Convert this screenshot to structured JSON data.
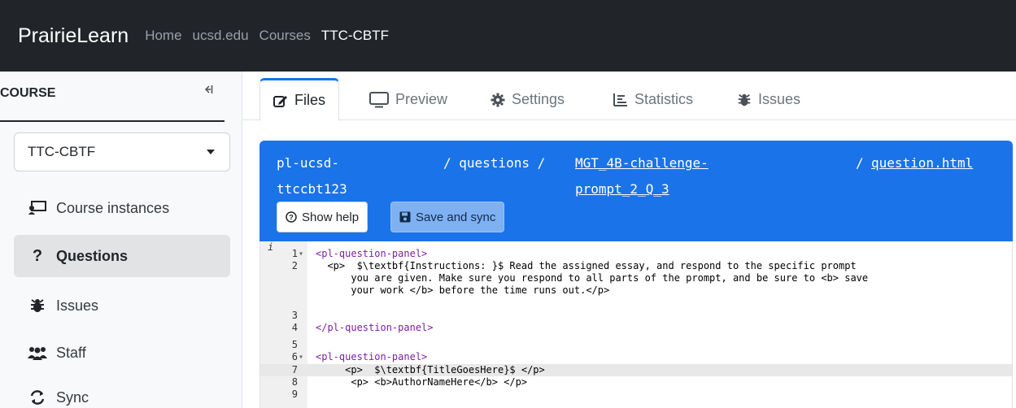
{
  "navbar": {
    "brand": "PrairieLearn",
    "links": [
      "Home",
      "ucsd.edu",
      "Courses",
      "TTC-CBTF"
    ]
  },
  "sidebar": {
    "header": "COURSE",
    "collapse_icon": "collapse-left-icon",
    "course_select": "TTC-CBTF",
    "items": [
      {
        "label": "Course instances",
        "icon": "chalkboard-icon"
      },
      {
        "label": "Questions",
        "icon": "question-icon"
      },
      {
        "label": "Issues",
        "icon": "bug-icon"
      },
      {
        "label": "Staff",
        "icon": "users-icon"
      },
      {
        "label": "Sync",
        "icon": "sync-icon"
      }
    ],
    "active_item": "Questions"
  },
  "tabs": [
    {
      "label": "Files",
      "icon": "edit-icon",
      "active": true
    },
    {
      "label": "Preview",
      "icon": "monitor-icon"
    },
    {
      "label": "Settings",
      "icon": "gear-icon"
    },
    {
      "label": "Statistics",
      "icon": "chart-icon"
    },
    {
      "label": "Issues",
      "icon": "bug-icon"
    }
  ],
  "breadcrumb": {
    "root_line1": "pl-ucsd-",
    "root_line2": "ttccbt123",
    "sep1": "/ questions /",
    "folder_line1": "MGT_4B-challenge-",
    "folder_line2": "prompt_2_Q_3",
    "sep2": "/",
    "file": "question.html"
  },
  "buttons": {
    "help": "Show help",
    "save": "Save and sync"
  },
  "editor": {
    "colors": {
      "tag": "#7a1fa2",
      "header": "#1a73e8"
    },
    "lines": [
      {
        "n": "1",
        "text": "<pl-question-panel>"
      },
      {
        "n": "2",
        "text": "  <p>  $\\textbf{Instructions: }$ Read the assigned essay, and respond to the specific prompt"
      },
      {
        "n": "",
        "text": "      you are given. Make sure you respond to all parts of the prompt, and be sure to <b> save"
      },
      {
        "n": "",
        "text": "      your work </b> before the time runs out.</p>"
      },
      {
        "n": "3",
        "text": ""
      },
      {
        "n": "4",
        "text": "</pl-question-panel>"
      },
      {
        "n": "5",
        "text": ""
      },
      {
        "n": "6",
        "text": "<pl-question-panel>"
      },
      {
        "n": "7",
        "text": "     <p>  $\\textbf{TitleGoesHere}$ </p>"
      },
      {
        "n": "8",
        "text": "      <p> <b>AuthorNameHere</b> </p>"
      },
      {
        "n": "9",
        "text": ""
      }
    ]
  }
}
